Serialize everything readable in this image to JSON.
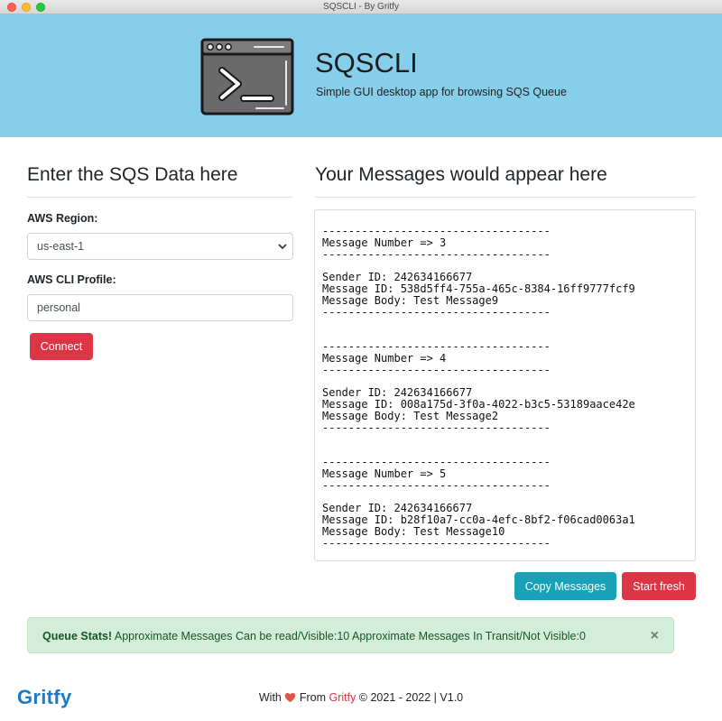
{
  "window": {
    "title": "SQSCLI - By Gritfy"
  },
  "header": {
    "title": "SQSCLI",
    "subtitle": "Simple GUI desktop app for browsing SQS Queue",
    "logo_icon": "terminal-window-icon"
  },
  "form": {
    "heading": "Enter the SQS Data here",
    "region_label": "AWS Region:",
    "region_value": "us-east-1",
    "profile_label": "AWS CLI Profile:",
    "profile_value": "personal",
    "connect_label": "Connect"
  },
  "messages": {
    "heading": "Your Messages would appear here",
    "content": "-----------------------------------\nMessage Number => 3\n-----------------------------------\n\nSender ID: 242634166677\nMessage ID: 538d5ff4-755a-465c-8384-16ff9777fcf9\nMessage Body: Test Message9\n-----------------------------------\n\n\n-----------------------------------\nMessage Number => 4\n-----------------------------------\n\nSender ID: 242634166677\nMessage ID: 008a175d-3f0a-4022-b3c5-53189aace42e\nMessage Body: Test Message2\n-----------------------------------\n\n\n-----------------------------------\nMessage Number => 5\n-----------------------------------\n\nSender ID: 242634166677\nMessage ID: b28f10a7-cc0a-4efc-8bf2-f06cad0063a1\nMessage Body: Test Message10\n-----------------------------------",
    "copy_label": "Copy Messages",
    "fresh_label": "Start fresh"
  },
  "alert": {
    "title": "Queue Stats!",
    "text": " Approximate Messages Can be read/Visible:10 Approximate Messages In Transit/Not Visible:0",
    "close": "×"
  },
  "footer": {
    "logo": "Gritfy",
    "prefix": "With ",
    "mid": " From ",
    "brand": "Gritfy",
    "suffix": " © 2021 - 2022 | V1.0"
  },
  "colors": {
    "hero_bg": "#87ceeb",
    "danger": "#dc3545",
    "info": "#17a2b8",
    "success_bg": "#d4edda",
    "brand_blue": "#1f78c5"
  }
}
